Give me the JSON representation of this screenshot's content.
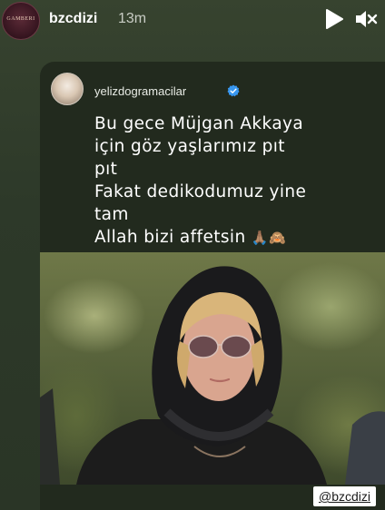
{
  "header": {
    "username": "bzcdizi",
    "timestamp": "13m",
    "avatar_text": "GAMBERI"
  },
  "repost": {
    "username": "yelizdogramacilar",
    "verified": true,
    "caption_lines": [
      "Bu gece Müjgan Akkaya",
      "için göz yaşlarımız pıt",
      "pıt",
      "Fakat dedikodumuz  yine",
      "tam",
      "Allah bizi affetsin"
    ],
    "caption_emoji": "🙏🏽🙈"
  },
  "mention_sticker": "@bzcdizi",
  "colors": {
    "background": "#2e3a2c",
    "card": "#222a1e",
    "verified": "#3897f0"
  },
  "icons": {
    "play": "play-icon",
    "mute": "volume-muted-icon",
    "verified": "verified-badge-icon"
  }
}
